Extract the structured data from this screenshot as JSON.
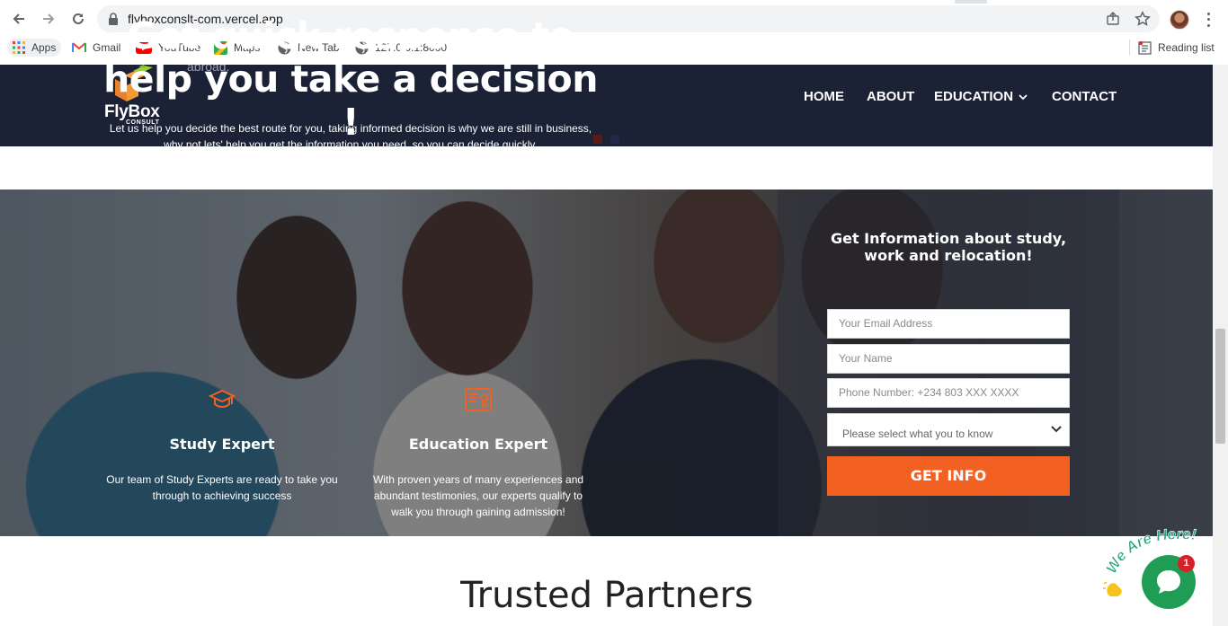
{
  "browser": {
    "url": "flyboxconslt-com.vercel.app",
    "bookmarks": [
      {
        "label": "Apps",
        "icon": "apps-grid-icon"
      },
      {
        "label": "Gmail",
        "icon": "gmail-icon"
      },
      {
        "label": "YouTube",
        "icon": "youtube-icon"
      },
      {
        "label": "Maps",
        "icon": "maps-icon"
      },
      {
        "label": "New Tab",
        "icon": "globe-icon"
      },
      {
        "label": "127.0.0.1:8000",
        "icon": "globe-icon"
      }
    ],
    "reading_list": "Reading list"
  },
  "header": {
    "ghost_text": "abroad.",
    "logo_text": "FlyBox",
    "logo_sub": "CONSULT",
    "nav": {
      "home": "HOME",
      "about": "ABOUT",
      "education": "EDUCATION",
      "contact": "CONTACT"
    }
  },
  "hero": {
    "title_line1": "Get quick response to",
    "title_line2": "help you take a decision !",
    "subtitle_line1": "Let us help you decide the best route for you, taking informed decision is why we are still in business,",
    "subtitle_line2": "why not lets' help you get the information you need, so you can decide quickly.",
    "features": [
      {
        "title": "Study Expert",
        "text_line1": "Our team of Study Experts are ready to take you",
        "text_line2": "through to achieving success",
        "icon": "graduation-cap-icon"
      },
      {
        "title": "Education Expert",
        "text_line1": "With proven years of many experiences and",
        "text_line2": "abundant testimonies, our experts qualify to",
        "text_line3": "walk you through gaining admission!",
        "icon": "certificate-icon"
      }
    ]
  },
  "form": {
    "title_line1": "Get Information about study,",
    "title_line2": "work and relocation!",
    "email_placeholder": "Your Email Address",
    "name_placeholder": "Your Name",
    "phone_placeholder": "Phone Number: +234 803 XXX XXXX",
    "select_value": "Please select what you to know",
    "submit_label": "GET INFO"
  },
  "partners": {
    "title": "Trusted Partners"
  },
  "chat": {
    "tagline": "We Are Here!",
    "badge_count": "1"
  },
  "colors": {
    "header_bg": "#1b2236",
    "accent_orange": "#f26122",
    "chat_green": "#1f9d55",
    "badge_red": "#d6202a"
  }
}
